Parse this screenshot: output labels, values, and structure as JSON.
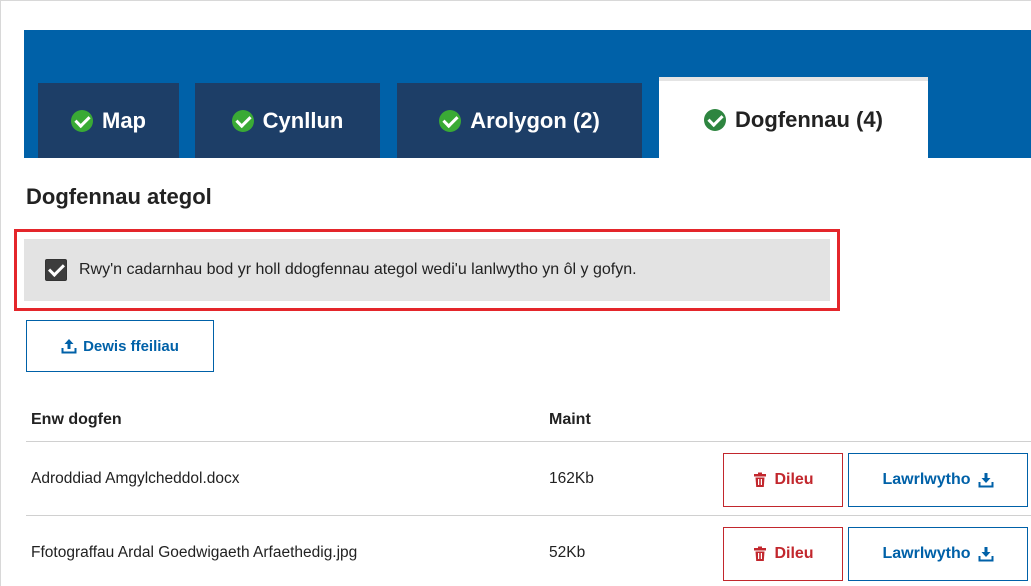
{
  "tabs": [
    {
      "label": "Map",
      "icon": "check-circle-icon",
      "active": false
    },
    {
      "label": "Cynllun",
      "icon": "check-circle-icon",
      "active": false
    },
    {
      "label": "Arolygon (2)",
      "icon": "check-circle-icon",
      "active": false
    },
    {
      "label": "Dogfennau (4)",
      "icon": "check-circle-icon",
      "active": true
    }
  ],
  "section": {
    "title": "Dogfennau ategol",
    "confirm_text": "Rwy'n cadarnhau bod yr holl ddogfennau ategol wedi'u lanlwytho yn ôl y gofyn.",
    "confirm_checked": true
  },
  "upload": {
    "label": "Dewis ffeiliau",
    "icon": "upload-icon"
  },
  "table": {
    "headers": {
      "name": "Enw dogfen",
      "size": "Maint"
    },
    "rows": [
      {
        "name": "Adroddiad Amgylcheddol.docx",
        "size": "162Kb",
        "delete_label": "Dileu",
        "download_label": "Lawrlwytho"
      },
      {
        "name": "Ffotograffau Ardal Goedwigaeth Arfaethedig.jpg",
        "size": "52Kb",
        "delete_label": "Dileu",
        "download_label": "Lawrlwytho"
      }
    ]
  },
  "colors": {
    "tab_bar": "#0061a8",
    "tab_inactive": "#1d3e67",
    "check_green": "#3aaa35",
    "highlight_red": "#e4262b",
    "danger": "#c2272d",
    "primary": "#0061a8"
  }
}
